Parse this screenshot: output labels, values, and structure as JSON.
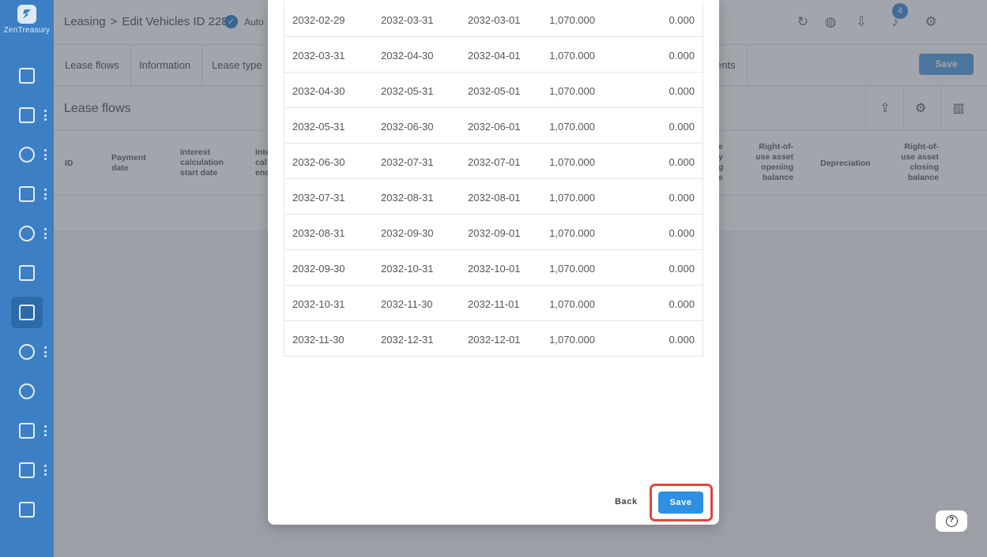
{
  "app": {
    "name": "ZenTreasury"
  },
  "header": {
    "breadcrumb_root": "Leasing",
    "breadcrumb_sep": ">",
    "breadcrumb_current": "Edit Vehicles ID 228",
    "auto_label": "Auto",
    "notification_count": "4"
  },
  "tabs": [
    "Lease flows",
    "Information",
    "Lease type"
  ],
  "tab_partial": "ents",
  "save_top_label": "Save",
  "section": {
    "title": "Lease flows"
  },
  "table_headers": {
    "id": "ID",
    "payment_date": "Payment date",
    "interest_start": "Interest calculation start date",
    "interest_end_partial": "Inte cal end",
    "liability_partial": "e y g e",
    "rou_opening": "Right-of-use asset opening balance",
    "depreciation": "Depreciation",
    "rou_closing": "Right-of-use asset closing balance"
  },
  "modal": {
    "rows": [
      [
        "2032-02-29",
        "2032-03-31",
        "2032-03-01",
        "1,070.000",
        "0.000"
      ],
      [
        "2032-03-31",
        "2032-04-30",
        "2032-04-01",
        "1,070.000",
        "0.000"
      ],
      [
        "2032-04-30",
        "2032-05-31",
        "2032-05-01",
        "1,070.000",
        "0.000"
      ],
      [
        "2032-05-31",
        "2032-06-30",
        "2032-06-01",
        "1,070.000",
        "0.000"
      ],
      [
        "2032-06-30",
        "2032-07-31",
        "2032-07-01",
        "1,070.000",
        "0.000"
      ],
      [
        "2032-07-31",
        "2032-08-31",
        "2032-08-01",
        "1,070.000",
        "0.000"
      ],
      [
        "2032-08-31",
        "2032-09-30",
        "2032-09-01",
        "1,070.000",
        "0.000"
      ],
      [
        "2032-09-30",
        "2032-10-31",
        "2032-10-01",
        "1,070.000",
        "0.000"
      ],
      [
        "2032-10-31",
        "2032-11-30",
        "2032-11-01",
        "1,070.000",
        "0.000"
      ],
      [
        "2032-11-30",
        "2032-12-31",
        "2032-12-01",
        "1,070.000",
        "0.000"
      ]
    ],
    "back_label": "Back",
    "save_label": "Save"
  },
  "help": {
    "label": "?"
  }
}
